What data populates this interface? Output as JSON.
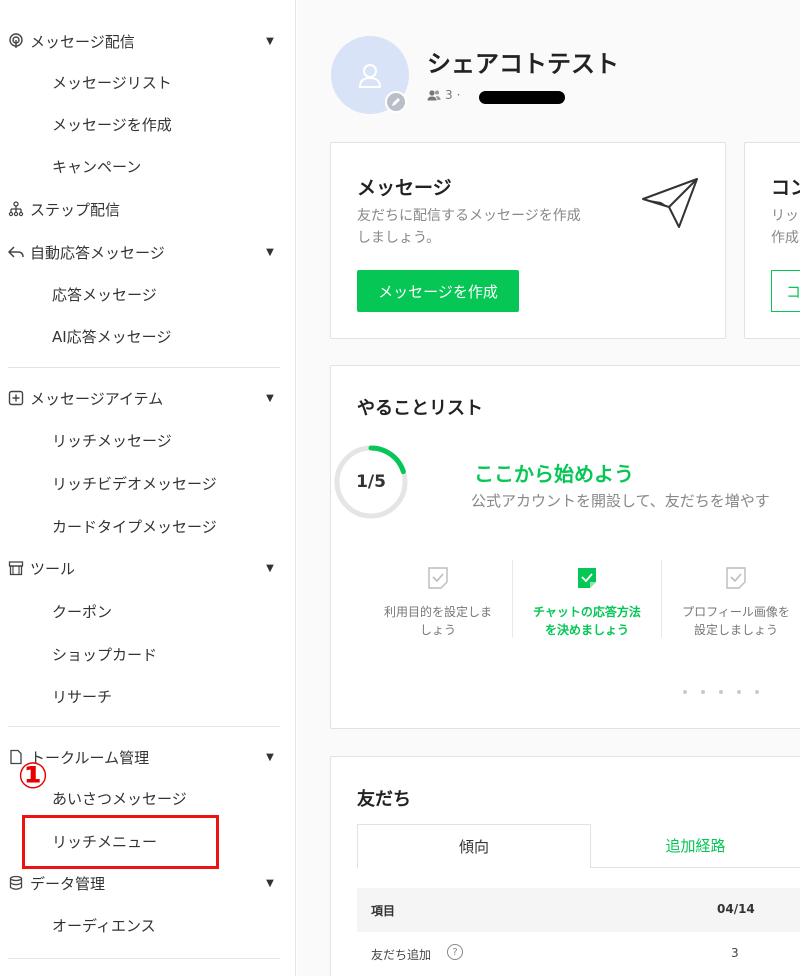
{
  "sidebar": {
    "message_delivery": {
      "label": "メッセージ配信",
      "items": [
        "メッセージリスト",
        "メッセージを作成",
        "キャンペーン"
      ]
    },
    "step_delivery": {
      "label": "ステップ配信"
    },
    "auto_reply": {
      "label": "自動応答メッセージ",
      "items": [
        "応答メッセージ",
        "AI応答メッセージ"
      ]
    },
    "message_items": {
      "label": "メッセージアイテム",
      "items": [
        "リッチメッセージ",
        "リッチビデオメッセージ",
        "カードタイプメッセージ"
      ]
    },
    "tools": {
      "label": "ツール",
      "items": [
        "クーポン",
        "ショップカード",
        "リサーチ"
      ]
    },
    "chatroom": {
      "label": "トークルーム管理",
      "items": [
        "あいさつメッセージ",
        "リッチメニュー"
      ]
    },
    "data_mgmt": {
      "label": "データ管理",
      "items": [
        "オーディエンス"
      ]
    }
  },
  "annotation": {
    "number": "①"
  },
  "account": {
    "name": "シェアコトテスト",
    "followers": "3",
    "separator": "·"
  },
  "message_card": {
    "title": "メッセージ",
    "desc_line1": "友だちに配信するメッセージを作成",
    "desc_line2": "しましょう。",
    "button": "メッセージを作成"
  },
  "coupon_card": {
    "title": "コン",
    "desc_line1": "リッ",
    "desc_line2": "作成",
    "button": "コ"
  },
  "todo": {
    "title": "やることリスト",
    "progress_label": "1/5",
    "progress_fraction": 0.2,
    "headline": "ここから始めよう",
    "subtext": "公式アカウントを開設して、友だちを増やす",
    "tasks": [
      {
        "line1": "利用目的を設定しま",
        "line2": "しょう"
      },
      {
        "line1": "チャットの応答方法",
        "line2": "を決めましょう"
      },
      {
        "line1": "プロフィール画像を",
        "line2": "設定しましょう"
      }
    ]
  },
  "friends": {
    "title": "友だち",
    "tabs": [
      "傾向",
      "追加経路"
    ],
    "columns": [
      "項目",
      "04/14"
    ],
    "rows": [
      {
        "label": "友だち追加",
        "value": "3"
      }
    ]
  },
  "colors": {
    "accent": "#06c755",
    "highlight": "#ee1111"
  }
}
